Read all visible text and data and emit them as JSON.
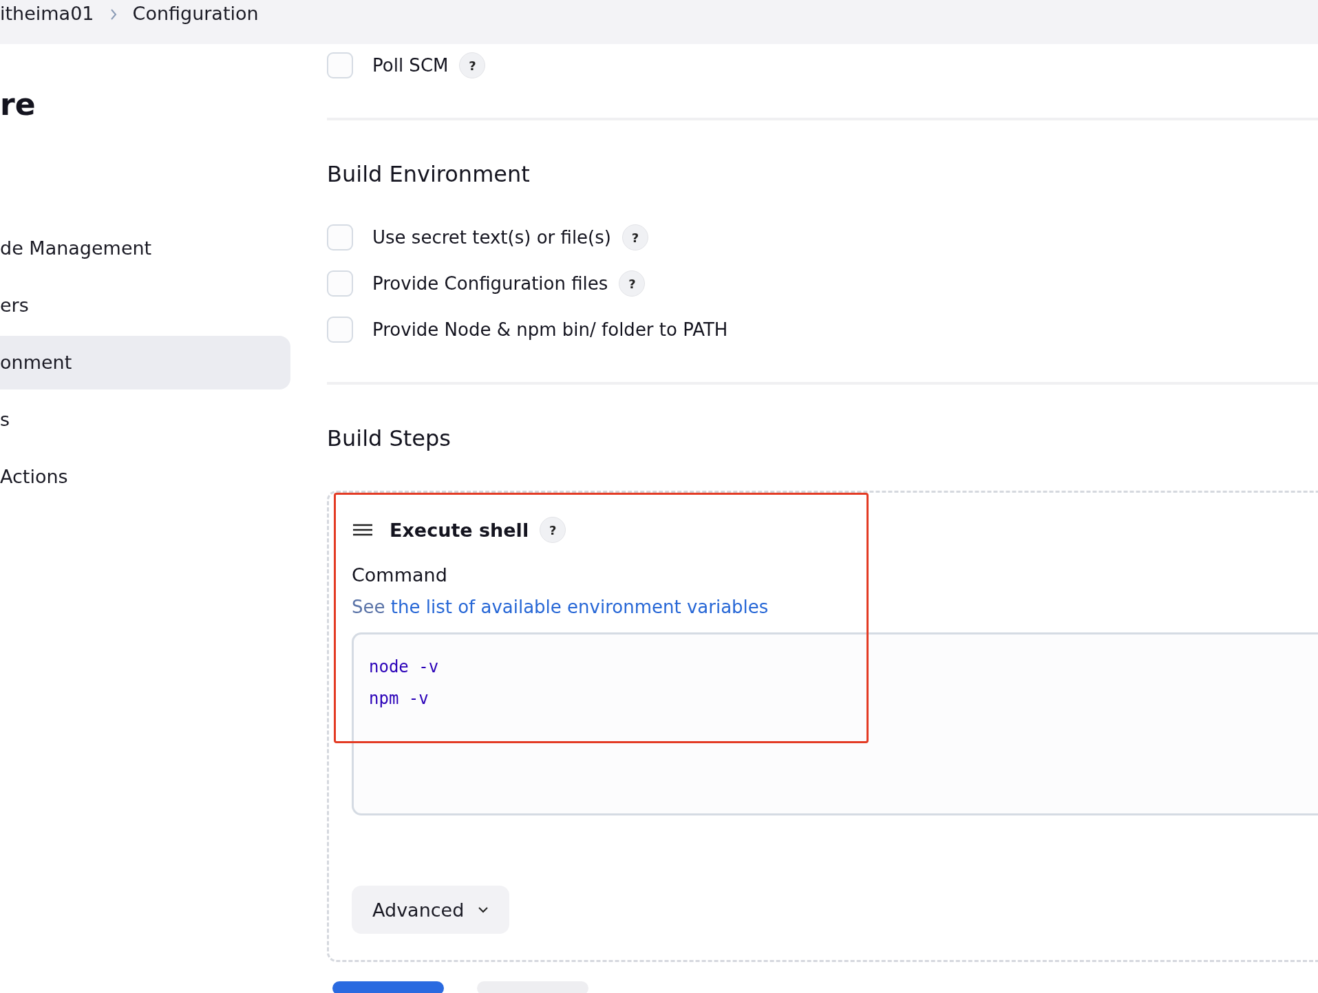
{
  "breadcrumb": [
    {
      "label": "itheima01"
    },
    {
      "label": "Configuration"
    }
  ],
  "sidebar": {
    "title": "re",
    "items": [
      {
        "label": "de Management",
        "selected": false
      },
      {
        "label": "ers",
        "selected": false
      },
      {
        "label": "onment",
        "selected": true
      },
      {
        "label": "s",
        "selected": false
      },
      {
        "label": " Actions",
        "selected": false
      }
    ]
  },
  "triggers": [
    {
      "label": "Poll SCM",
      "checked": false,
      "help": "?"
    }
  ],
  "build_environment": {
    "title": "Build Environment",
    "options": [
      {
        "label": "Use secret text(s) or file(s)",
        "checked": false,
        "help": "?"
      },
      {
        "label": "Provide Configuration files",
        "checked": false,
        "help": "?"
      },
      {
        "label": "Provide Node & npm bin/ folder to PATH",
        "checked": false
      }
    ]
  },
  "build_steps": {
    "title": "Build Steps",
    "steps": [
      {
        "title": "Execute shell",
        "help": "?",
        "highlighted": true,
        "command_label": "Command",
        "link_prefix": "See",
        "link_text": "the list of available environment variables",
        "command_lines": [
          "node -v",
          "npm -v"
        ],
        "advanced_button": "Advanced"
      }
    ]
  }
}
